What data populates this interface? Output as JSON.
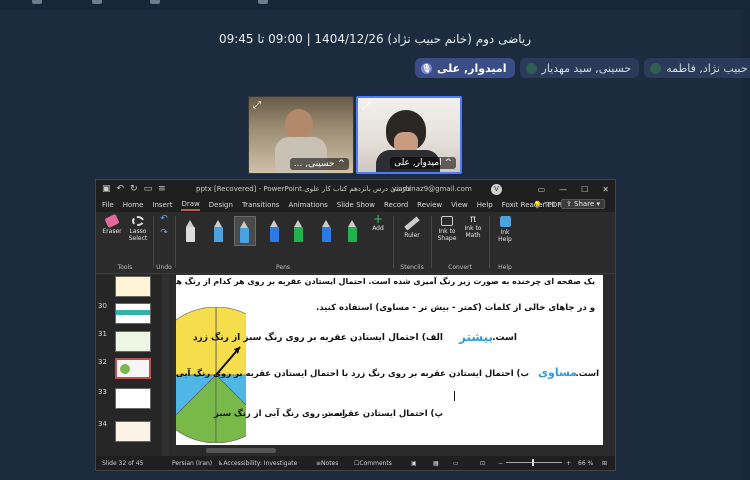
{
  "meeting": {
    "title": "ریاضی دوم (خانم حبیب نژاد) 1404/12/26 | 09:00 تا 09:45"
  },
  "participants": [
    {
      "name": "امیدوار, علی",
      "active": true
    },
    {
      "name": "حسینی, سید مهدیار",
      "active": false
    },
    {
      "name": "حبیب نژاد, فاطمه",
      "active": false
    }
  ],
  "videos": [
    {
      "name": "^ حسینی, ..."
    },
    {
      "name": "^ امیدوار, علی"
    }
  ],
  "ppt": {
    "title": "فارسی درس بانزدهم کتاب کار علوی.pptx [Recovered] - PowerPoint",
    "account": "vinminaz9@gmail.com",
    "avatar": "V",
    "menu": [
      "File",
      "Home",
      "Insert",
      "Draw",
      "Design",
      "Transitions",
      "Animations",
      "Slide Show",
      "Record",
      "Review",
      "View",
      "Help",
      "Foxit Reader PDF"
    ],
    "selected_menu": "Draw",
    "tell_me": "Tell me",
    "share": "Share",
    "ribbon": {
      "eraser": "Eraser",
      "lasso": "Lasso Select",
      "tools_group": "Tools",
      "undo_group": "Undo",
      "pens_group": "Pens",
      "add": "Add",
      "ruler": "Ruler",
      "stencils_group": "Stencils",
      "ink_to_shape": "Ink to Shape",
      "ink_to_math": "Ink to Math",
      "convert_group": "Convert",
      "ink_help": "Ink Help",
      "help_group": "Help"
    },
    "pen_colors": [
      "#eeeeee",
      "#4aa3df",
      "#4aa3df",
      "#2c7be5",
      "#22b14c",
      "#2c7be5",
      "#22b14c"
    ],
    "thumbnails": [
      {
        "num": "",
        "kind": "s1"
      },
      {
        "num": "30",
        "kind": "teal"
      },
      {
        "num": "31",
        "kind": "s31"
      },
      {
        "num": "32",
        "kind": "sel"
      },
      {
        "num": "33",
        "kind": "s33"
      },
      {
        "num": "34",
        "kind": "s34"
      }
    ],
    "slide_lines": [
      "یک صفحه ای چرخنده به صورت زیر رنگ آمیزی شده است. احتمال ایستادن عقربه بر روی هر کدام از رنگ ها را مقایسه کرده",
      "و در جاهای خالی از کلمات (کمتر - بیش تر - مساوی) استفاده کنید.",
      "الف) احتمال ایستادن عقربه بر روی رنگ سبز از رنگ زرد",
      "ب) احتمال ایستادن عقربه بر روی رنگ زرد با احتمال ایستادن عقربه بر روی رنگ آبی",
      "پ) احتمال ایستادن عقربه بر روی رنگ آبی از رنگ سبز",
      "است."
    ],
    "handwriting": {
      "a": "بیشتر",
      "b": "مساوی"
    },
    "status": {
      "slide": "Slide 32 of 45",
      "language": "Persian (Iran)",
      "accessibility": "Accessibility: Investigate",
      "notes": "Notes",
      "comments": "Comments",
      "zoom": "66 %"
    },
    "spinner_colors": {
      "yellow": "#f6dd4b",
      "blue": "#4fb7e6",
      "green": "#79b94a"
    }
  }
}
